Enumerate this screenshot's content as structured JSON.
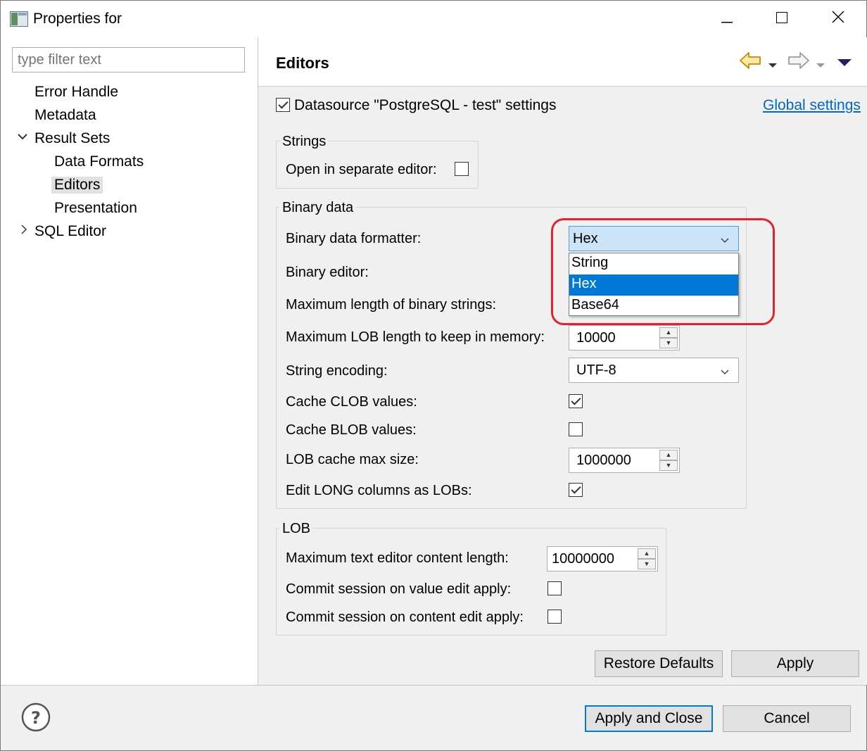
{
  "window": {
    "title": "Properties for",
    "controls": {
      "minimize": "minimize-icon",
      "maximize": "maximize-icon",
      "close": "close-icon"
    }
  },
  "sidebar": {
    "filter_placeholder": "type filter text",
    "items": [
      {
        "label": "Error Handle"
      },
      {
        "label": "Metadata"
      },
      {
        "label": "Result Sets",
        "expanded": true
      },
      {
        "label": "Data Formats"
      },
      {
        "label": "Editors",
        "selected": true
      },
      {
        "label": "Presentation"
      },
      {
        "label": "SQL Editor",
        "expanded": false
      }
    ]
  },
  "page": {
    "title": "Editors",
    "datasource_label": "Datasource \"PostgreSQL - test\" settings",
    "datasource_checked": true,
    "global_settings_link": "Global settings"
  },
  "strings_group": {
    "title": "Strings",
    "open_separate_label": "Open in separate editor:",
    "open_separate_checked": false
  },
  "binary_group": {
    "title": "Binary data",
    "formatter_label": "Binary data formatter:",
    "formatter_value": "Hex",
    "formatter_options": [
      "String",
      "Hex",
      "Base64"
    ],
    "binary_editor_label": "Binary editor:",
    "max_binary_len_label": "Maximum length of binary strings:",
    "max_lob_mem_label": "Maximum LOB length to keep in memory:",
    "max_lob_mem_value": "10000",
    "encoding_label": "String encoding:",
    "encoding_value": "UTF-8",
    "cache_clob_label": "Cache CLOB values:",
    "cache_clob_checked": true,
    "cache_blob_label": "Cache BLOB values:",
    "cache_blob_checked": false,
    "lob_cache_max_label": "LOB cache max size:",
    "lob_cache_max_value": "1000000",
    "edit_long_label": "Edit LONG columns as LOBs:",
    "edit_long_checked": true
  },
  "lob_group": {
    "title": "LOB",
    "max_text_label": "Maximum text editor content length:",
    "max_text_value": "10000000",
    "commit_value_label": "Commit session on value edit apply:",
    "commit_value_checked": false,
    "commit_content_label": "Commit session on content edit apply:",
    "commit_content_checked": false
  },
  "buttons": {
    "restore_defaults": "Restore Defaults",
    "apply": "Apply",
    "apply_close": "Apply and Close",
    "cancel": "Cancel"
  },
  "colors": {
    "accent": "#0078d7",
    "highlight_ring": "#e0242c",
    "link": "#0066cc"
  }
}
